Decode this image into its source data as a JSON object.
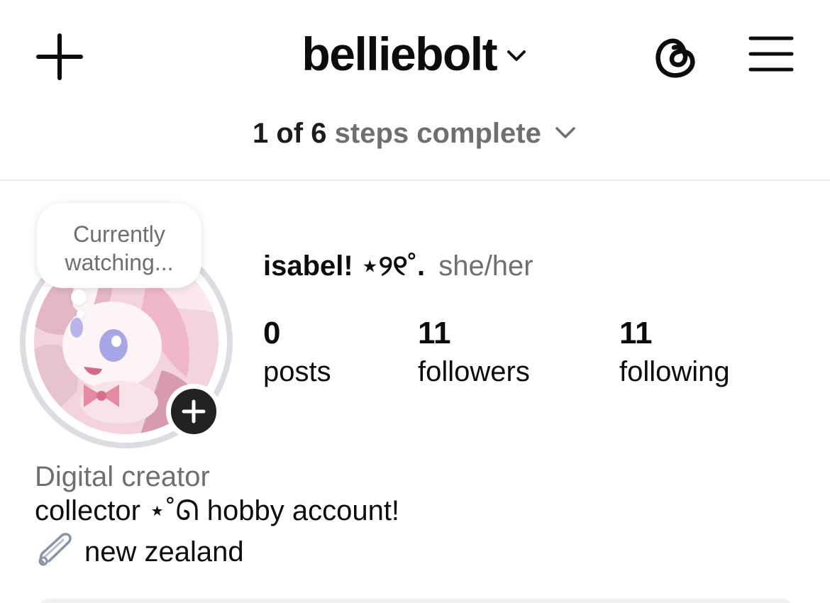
{
  "header": {
    "username": "belliebolt",
    "icons": {
      "create": "plus-icon",
      "account_switcher": "chevron-down-icon",
      "threads": "threads-icon",
      "menu": "hamburger-menu-icon"
    }
  },
  "onboarding": {
    "steps_count": "1 of 6",
    "steps_label": "steps complete"
  },
  "profile": {
    "note": {
      "line1": "Currently",
      "line2": "watching..."
    },
    "avatar_icon": "avatar-illustration",
    "add_story_icon": "plus-icon",
    "display_name": "isabel! ⋆୨୧˚.",
    "pronouns": "she/her",
    "stats": [
      {
        "value": "0",
        "label": "posts"
      },
      {
        "value": "11",
        "label": "followers"
      },
      {
        "value": "11",
        "label": "following"
      }
    ],
    "category": "Digital creator",
    "bio": "collector ⋆˚ᘏ hobby account!",
    "location": "new zealand",
    "location_icon": "safety-pin-icon"
  },
  "colors": {
    "text_primary": "#0c0c0d",
    "text_secondary": "#6e6e73",
    "ring": "#dcdce2",
    "badge": "#222225"
  }
}
